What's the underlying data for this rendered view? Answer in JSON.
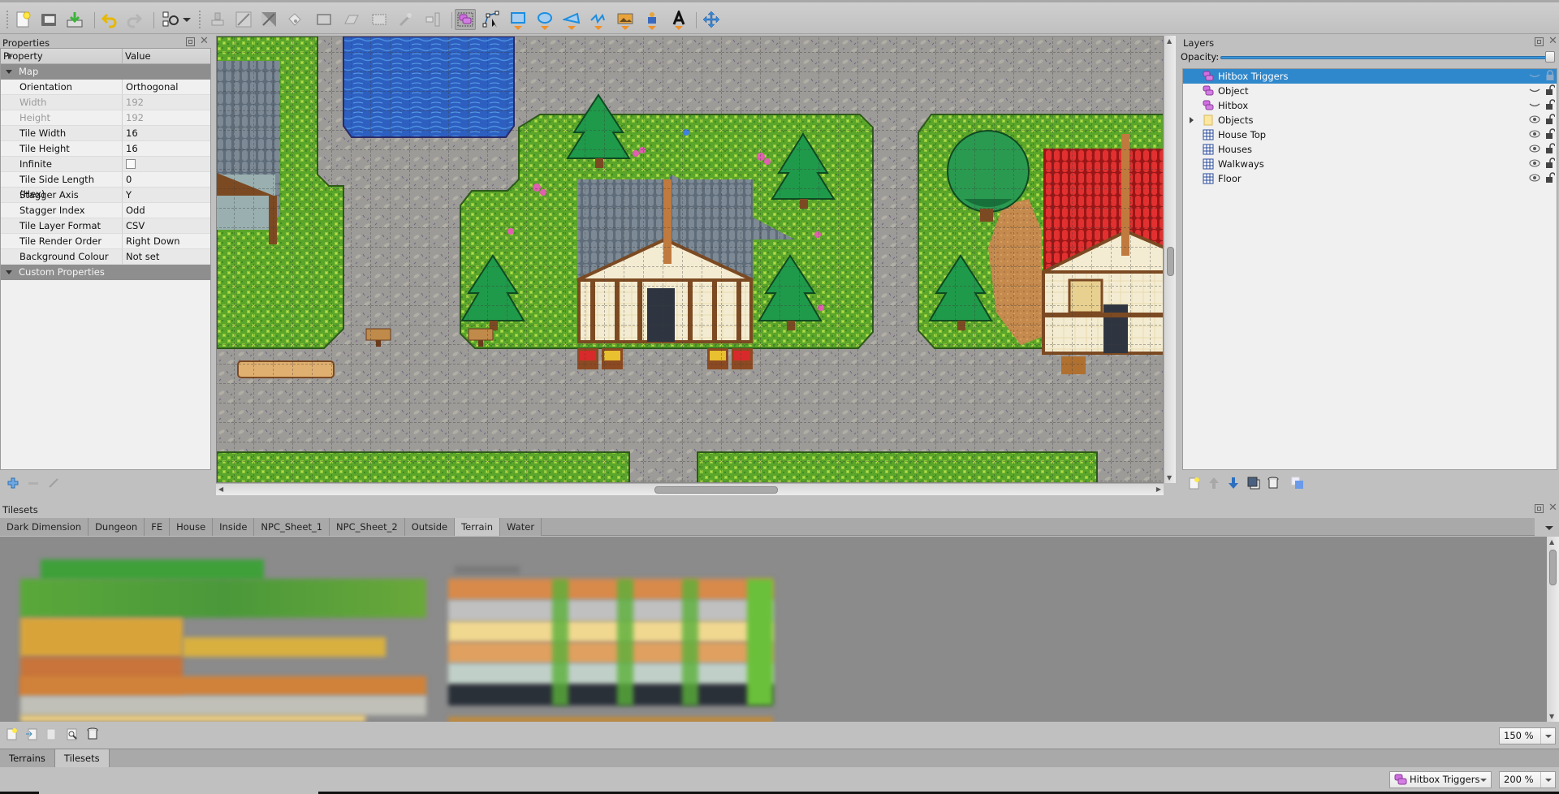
{
  "toolbar": {
    "buttons": [
      {
        "name": "new-map",
        "icon": "new-document-icon"
      },
      {
        "name": "open",
        "icon": "folder-icon"
      },
      {
        "name": "save",
        "icon": "save-icon"
      },
      {
        "name": "undo",
        "icon": "undo-icon"
      },
      {
        "name": "redo",
        "icon": "redo-icon"
      },
      {
        "name": "commands",
        "icon": "gears-icon"
      },
      {
        "name": "stamp-brush",
        "icon": "stamp-icon"
      },
      {
        "name": "terrain-brush",
        "icon": "terrain-brush-icon"
      },
      {
        "name": "wang-brush",
        "icon": "wang-brush-icon"
      },
      {
        "name": "bucket-fill",
        "icon": "bucket-icon"
      },
      {
        "name": "shape-fill",
        "icon": "rectangle-fill-icon"
      },
      {
        "name": "eraser",
        "icon": "eraser-icon"
      },
      {
        "name": "rect-select",
        "icon": "rect-select-icon"
      },
      {
        "name": "magic-wand",
        "icon": "magic-wand-icon"
      },
      {
        "name": "select-same-tile",
        "icon": "select-same-icon"
      },
      {
        "name": "select-objects",
        "icon": "select-objects-icon",
        "active": true
      },
      {
        "name": "edit-polygons",
        "icon": "edit-polygon-icon"
      },
      {
        "name": "insert-rectangle",
        "icon": "rectangle-icon"
      },
      {
        "name": "insert-ellipse",
        "icon": "ellipse-icon"
      },
      {
        "name": "insert-polygon",
        "icon": "polygon-icon"
      },
      {
        "name": "insert-polyline",
        "icon": "polyline-icon"
      },
      {
        "name": "insert-tile",
        "icon": "image-icon"
      },
      {
        "name": "insert-template",
        "icon": "template-icon"
      },
      {
        "name": "insert-text",
        "icon": "text-icon"
      },
      {
        "name": "world-tool",
        "icon": "move-icon"
      }
    ]
  },
  "properties": {
    "title": "Properties",
    "columns": [
      "Property",
      "Value"
    ],
    "groups": [
      {
        "label": "Map",
        "rows": [
          {
            "key": "Orientation",
            "value": "Orthogonal",
            "disabled": false
          },
          {
            "key": "Width",
            "value": "192",
            "disabled": true
          },
          {
            "key": "Height",
            "value": "192",
            "disabled": true
          },
          {
            "key": "Tile Width",
            "value": "16",
            "disabled": false
          },
          {
            "key": "Tile Height",
            "value": "16",
            "disabled": false
          },
          {
            "key": "Infinite",
            "value": "",
            "checkbox": false,
            "disabled": false
          },
          {
            "key": "Tile Side Length (Hex)",
            "value": "0",
            "disabled": false
          },
          {
            "key": "Stagger Axis",
            "value": "Y",
            "disabled": false
          },
          {
            "key": "Stagger Index",
            "value": "Odd",
            "disabled": false
          },
          {
            "key": "Tile Layer Format",
            "value": "CSV",
            "disabled": false
          },
          {
            "key": "Tile Render Order",
            "value": "Right Down",
            "disabled": false
          },
          {
            "key": "Background Colour",
            "value": "Not set",
            "disabled": false,
            "expandable": true
          }
        ]
      },
      {
        "label": "Custom Properties",
        "rows": []
      }
    ],
    "footer_buttons": [
      "add-property",
      "remove-property",
      "rename-property"
    ]
  },
  "layers": {
    "title": "Layers",
    "opacity_label": "Opacity:",
    "opacity": 1.0,
    "items": [
      {
        "name": "Hitbox Triggers",
        "type": "object-layer",
        "visible": false,
        "locked": true,
        "selected": true
      },
      {
        "name": "Object",
        "type": "object-layer",
        "visible": false,
        "locked": false
      },
      {
        "name": "Hitbox",
        "type": "object-layer",
        "visible": false,
        "locked": false
      },
      {
        "name": "Objects",
        "type": "group-layer",
        "visible": true,
        "locked": false,
        "expandable": true
      },
      {
        "name": "House Top",
        "type": "tile-layer",
        "visible": true,
        "locked": false
      },
      {
        "name": "Houses",
        "type": "tile-layer",
        "visible": true,
        "locked": false
      },
      {
        "name": "Walkways",
        "type": "tile-layer",
        "visible": true,
        "locked": false
      },
      {
        "name": "Floor",
        "type": "tile-layer",
        "visible": true,
        "locked": false
      }
    ],
    "footer_buttons": [
      "new-layer",
      "raise-layer",
      "lower-layer",
      "duplicate-layer",
      "remove-layer",
      "toggle-other-layers"
    ]
  },
  "tilesets": {
    "title": "Tilesets",
    "tabs": [
      "Dark Dimension",
      "Dungeon",
      "FE",
      "House",
      "Inside",
      "NPC_Sheet_1",
      "NPC_Sheet_2",
      "Outside",
      "Terrain",
      "Water"
    ],
    "active_tab": "Terrain",
    "zoom": "150 %",
    "footer_buttons": [
      "new-tileset",
      "import-tileset",
      "export-tileset",
      "edit-tileset",
      "remove-tileset"
    ]
  },
  "bottom_tabs": {
    "tabs": [
      "Terrains",
      "Tilesets"
    ],
    "active": "Tilesets"
  },
  "statusbar": {
    "current_layer": "Hitbox Triggers",
    "zoom": "200 %"
  }
}
